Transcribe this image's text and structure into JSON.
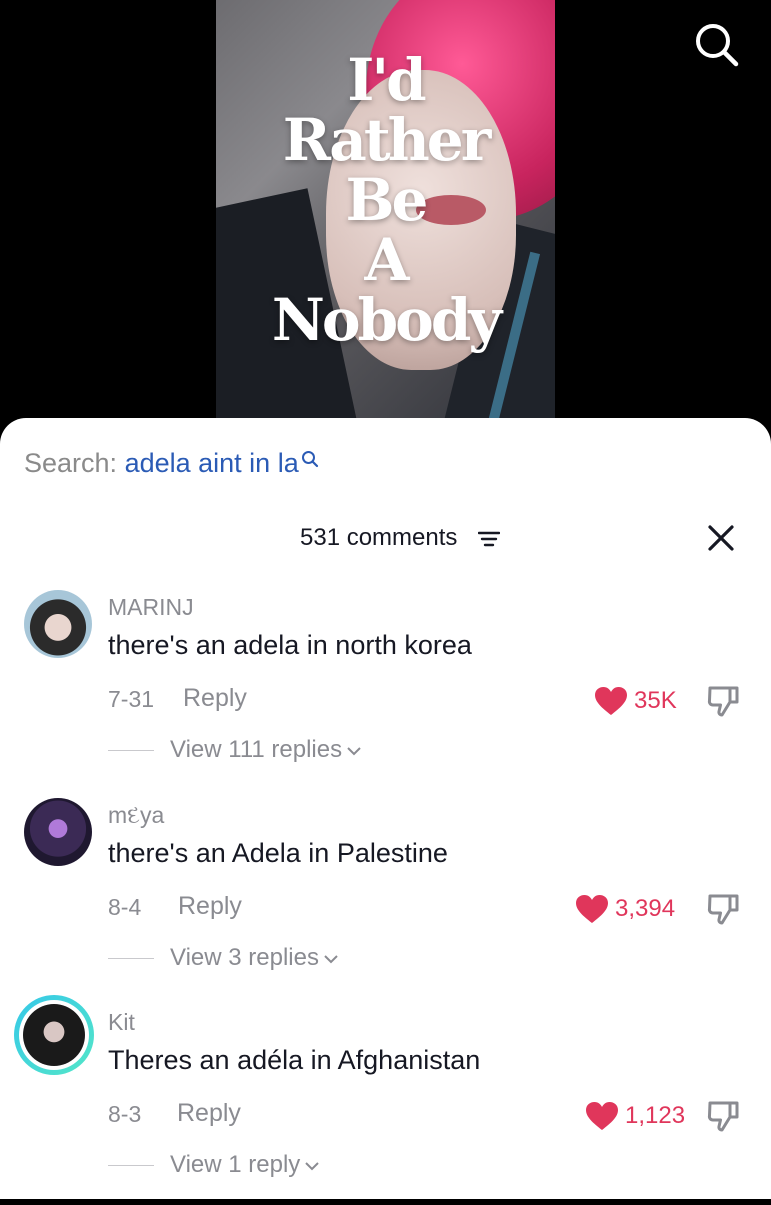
{
  "video": {
    "overlay_lines": [
      "I'd",
      "Rather",
      "Be",
      "A",
      "Nobody"
    ]
  },
  "search": {
    "prefix": "Search:",
    "query": "adela aint in la"
  },
  "comments_header": {
    "count_label": "531 comments"
  },
  "comments": [
    {
      "username": "MARINJ",
      "text": "there's an adela in north korea",
      "date": "7-31",
      "reply_label": "Reply",
      "likes": "35K",
      "view_replies": "View 111 replies"
    },
    {
      "username": "mદya",
      "text": "there's an Adela in Palestine",
      "date": "8-4",
      "reply_label": "Reply",
      "likes": "3,394",
      "view_replies": "View 3 replies"
    },
    {
      "username": "Kit",
      "text": "Theres an adéla in Afghanistan",
      "date": "8-3",
      "reply_label": "Reply",
      "likes": "1,123",
      "view_replies": "View 1 reply"
    }
  ],
  "colors": {
    "like": "#e0365b",
    "link": "#2b5bb5",
    "muted": "#8a8b91",
    "text": "#161823"
  },
  "icons": [
    "search-icon",
    "sort-icon",
    "close-icon",
    "heart-icon",
    "dislike-icon",
    "chevron-down-icon"
  ]
}
